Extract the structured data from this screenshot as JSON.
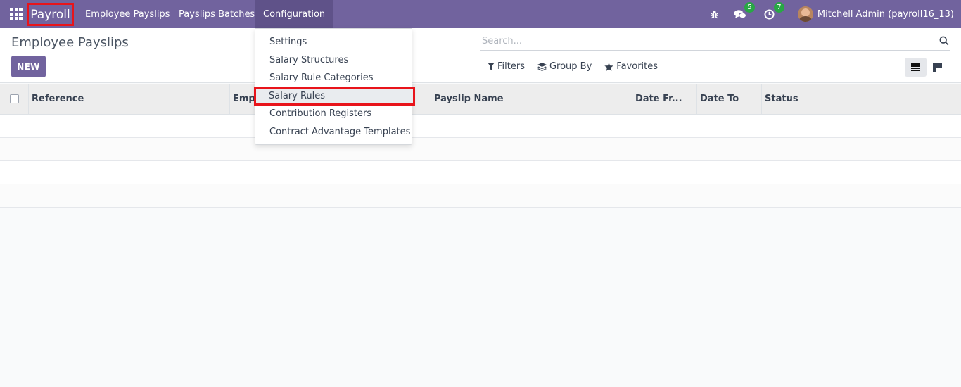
{
  "navbar": {
    "app_name": "Payroll",
    "menu": [
      {
        "label": "Employee Payslips"
      },
      {
        "label": "Payslips Batches"
      },
      {
        "label": "Configuration"
      }
    ],
    "messages_count": "5",
    "activities_count": "7",
    "user_label": "Mitchell Admin (payroll16_13)"
  },
  "control_panel": {
    "title": "Employee Payslips",
    "new_label": "NEW",
    "search_placeholder": "Search...",
    "filters_label": "Filters",
    "groupby_label": "Group By",
    "favorites_label": "Favorites"
  },
  "table": {
    "columns": [
      "Reference",
      "Empl",
      "Payslip Name",
      "Date Fr...",
      "Date To",
      "Status"
    ]
  },
  "config_menu": {
    "items": [
      {
        "label": "Settings"
      },
      {
        "label": "Salary Structures"
      },
      {
        "label": "Salary Rule Categories"
      },
      {
        "label": "Salary Rules"
      },
      {
        "label": "Contribution Registers"
      },
      {
        "label": "Contract Advantage Templates"
      }
    ]
  },
  "colors": {
    "brand": "#71639e",
    "highlight_border": "#e8141b",
    "badge": "#28a745"
  }
}
